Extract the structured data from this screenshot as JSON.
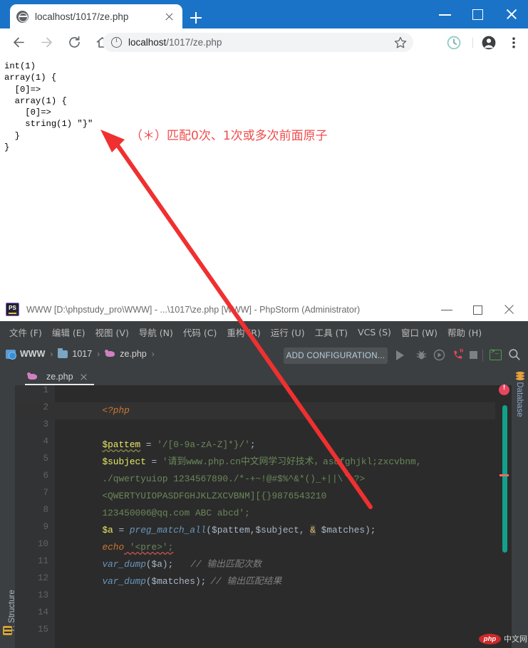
{
  "browser": {
    "tab": {
      "title": "localhost/1017/ze.php",
      "favicon": "globe-icon",
      "close": "×"
    },
    "new_tab_label": "+",
    "window_controls": {
      "minimize": "−",
      "maximize": "□",
      "close": "×"
    },
    "toolbar": {
      "back": "back-arrow-icon",
      "forward": "forward-arrow-icon",
      "reload": "reload-icon",
      "home": "home-icon",
      "site_info": "info-icon",
      "url_host": "localhost",
      "url_path": "/1017/ze.php",
      "bookmark": "star-icon",
      "history": "clock-icon",
      "profile": "avatar-icon",
      "menu": "three-dot-menu-icon"
    },
    "page_output": "int(1)\narray(1) {\n  [0]=>\n  array(1) {\n    [0]=>\n    string(1) \"}\"\n  }\n}",
    "annotation": {
      "text": "（＊）匹配0次、1次或多次前面原子",
      "color": "#ef4b4b",
      "arrow_color": "#f03030"
    }
  },
  "phpstorm": {
    "title": "WWW [D:\\phpstudy_pro\\WWW] - ...\\1017\\ze.php [WWW] - PhpStorm (Administrator)",
    "app_icon": "phpstorm-logo-icon",
    "window_controls": {
      "minimize": "−",
      "maximize": "□",
      "close": "×"
    },
    "menu": [
      "文件 (F)",
      "编辑 (E)",
      "视图 (V)",
      "导航 (N)",
      "代码 (C)",
      "重构 (R)",
      "运行 (U)",
      "工具 (T)",
      "VCS (S)",
      "窗口 (W)",
      "帮助 (H)"
    ],
    "breadcrumbs": [
      {
        "label": "WWW",
        "icon": "module-icon"
      },
      {
        "label": "1017",
        "icon": "folder-icon"
      },
      {
        "label": "ze.php",
        "icon": "php-elephant-icon"
      }
    ],
    "breadcrumb_separator": "›",
    "run_toolbar": {
      "add_configuration": "ADD CONFIGURATION...",
      "run": "run-triangle-icon",
      "debug": "debug-bug-icon",
      "run_coverage": "coverage-icon",
      "profile": "profile-phone-icon",
      "stop": "stop-square-icon",
      "terminal": "terminal-icon",
      "search": "search-icon"
    },
    "editor_tab": {
      "label": "ze.php",
      "icon": "php-elephant-icon",
      "close": "×"
    },
    "left_rail": {
      "label": "7: Structure",
      "icon": "structure-icon"
    },
    "right_rail": {
      "label": "Database",
      "icon": "database-cylinder-icon"
    },
    "error_badge": "!",
    "gutter_lines": [
      "1",
      "2",
      "3",
      "4",
      "5",
      "6",
      "7",
      "8",
      "9",
      "10",
      "11",
      "12",
      "13",
      "14",
      "15"
    ],
    "current_line": 2,
    "code": {
      "l1_open": "<?php",
      "l3_var": "$pattem",
      "l3_eq": " = ",
      "l3_str": "'/[0-9a-zA-Z]*}/'",
      "l3_end": ";",
      "l4_var": "$subject",
      "l4_eq": " = ",
      "l4_str": "'请到www.php.cn中文网学习好技术，asdfghjkl;zxcvbnm,",
      "l5_str": "./qwertyuiop 1234567890./*-+~!@#$%^&*()_+||\\`~?>",
      "l6_str": "<QWERTYUIOPASDFGHJKLZXCVBNM][{}9876543210",
      "l7_str": "123450006@qq.com ABC abcd';",
      "l8_var": "$a",
      "l8_eq": " = ",
      "l8_fn": "preg_match_all",
      "l8_args_a": "($pattem,$subject, ",
      "l8_amp": "&",
      "l8_args_b": " $matches);",
      "l9_kw": "echo",
      "l9_str": " '<pre>';",
      "l10_fn": "var_dump",
      "l10_args": "($a);",
      "l10_cmt": "// 输出匹配次数",
      "l11_fn": "var_dump",
      "l11_args": "($matches);",
      "l11_cmt": "// 输出匹配结果"
    },
    "watermark": {
      "logo": "php",
      "text": "中文网"
    }
  }
}
